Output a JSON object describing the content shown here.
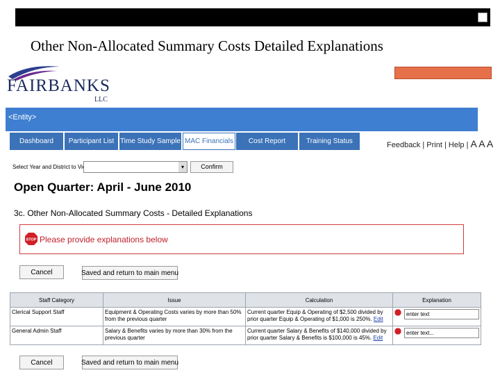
{
  "slide": {
    "title": "Other Non-Allocated Summary Costs Detailed Explanations"
  },
  "logo": {
    "name": "FAIRBANKS",
    "suffix": "LLC"
  },
  "entity_bar": {
    "label": "<Entity>"
  },
  "nav": {
    "tabs": [
      {
        "label": "Dashboard"
      },
      {
        "label": "Participant List"
      },
      {
        "label": "Time Study Sample"
      },
      {
        "label": "MAC Financials"
      },
      {
        "label": "Cost Report"
      },
      {
        "label": "Training Status"
      }
    ],
    "active_tab": "MAC Financials"
  },
  "utility": {
    "feedback": "Feedback",
    "print": "Print",
    "help": "Help",
    "font_sizes": "A A A"
  },
  "selector": {
    "label": "Select Year and District to View",
    "value": "",
    "confirm_label": "Confirm"
  },
  "page": {
    "quarter_title": "Open Quarter: April - June 2010",
    "section_title": "3c. Other Non-Allocated Summary Costs - Detailed Explanations"
  },
  "alert": {
    "icon": "stop-sign-icon",
    "message": "Please provide explanations below",
    "color": "#c0202a"
  },
  "actions": {
    "cancel_label": "Cancel",
    "save_label": "Saved and return to main menu"
  },
  "table": {
    "headers": [
      "Staff Category",
      "Issue",
      "Calculation",
      "Explanation"
    ],
    "rows": [
      {
        "category": "Clerical Support Staff",
        "issue": "Equipment & Operating Costs varies by more than 50% from the previous quarter",
        "calculation": "Current quarter Equip & Operating of $2,500 divided by prior quarter Equip & Operating of $1,000 is 250%.",
        "edit_label": "Edit",
        "explanation": "enter text"
      },
      {
        "category": "General Admin Staff",
        "issue": "Salary & Benefits varies by more than 30% from the previous quarter",
        "calculation": "Current quarter Salary & Benefits of $140,000 divided by prior quarter Salary & Benefits is $100,000 is 45%.",
        "edit_label": "Edit",
        "explanation": "enter text..."
      }
    ]
  },
  "colors": {
    "entity_bar": "#3f7fd1",
    "nav_tab": "#3b72b8",
    "brand": "#1a2a5c"
  }
}
